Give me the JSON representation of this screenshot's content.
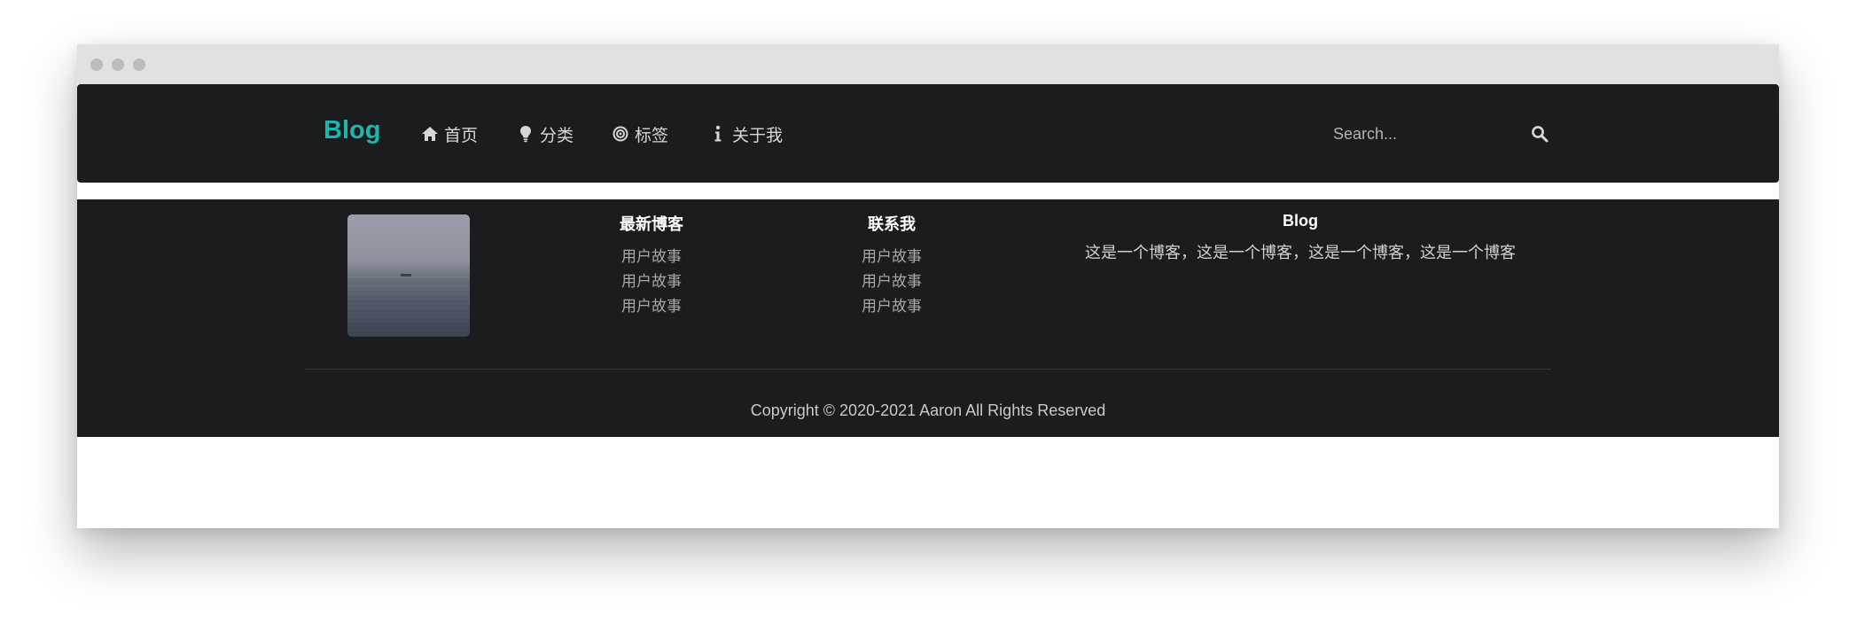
{
  "navbar": {
    "brand": "Blog",
    "items": [
      {
        "label": "首页",
        "icon": "home-icon"
      },
      {
        "label": "分类",
        "icon": "lightbulb-icon"
      },
      {
        "label": "标签",
        "icon": "bullseye-icon"
      },
      {
        "label": "关于我",
        "icon": "info-icon"
      }
    ],
    "search": {
      "placeholder": "Search...",
      "value": "",
      "icon": "search-icon"
    }
  },
  "footer": {
    "image": {
      "description_icon": "photo-sea"
    },
    "latest": {
      "title": "最新博客",
      "links": [
        "用户故事",
        "用户故事",
        "用户故事"
      ]
    },
    "contact": {
      "title": "联系我",
      "links": [
        "用户故事",
        "用户故事",
        "用户故事"
      ]
    },
    "blog": {
      "title": "Blog",
      "description": "这是一个博客，这是一个博客，这是一个博客，这是一个博客"
    },
    "copyright": "Copyright © 2020-2021 Aaron All Rights Reserved"
  },
  "colors": {
    "brand": "#1fb5ac",
    "navbar_bg": "#1b1c1d",
    "titlebar_bg": "#e1e1e1"
  }
}
